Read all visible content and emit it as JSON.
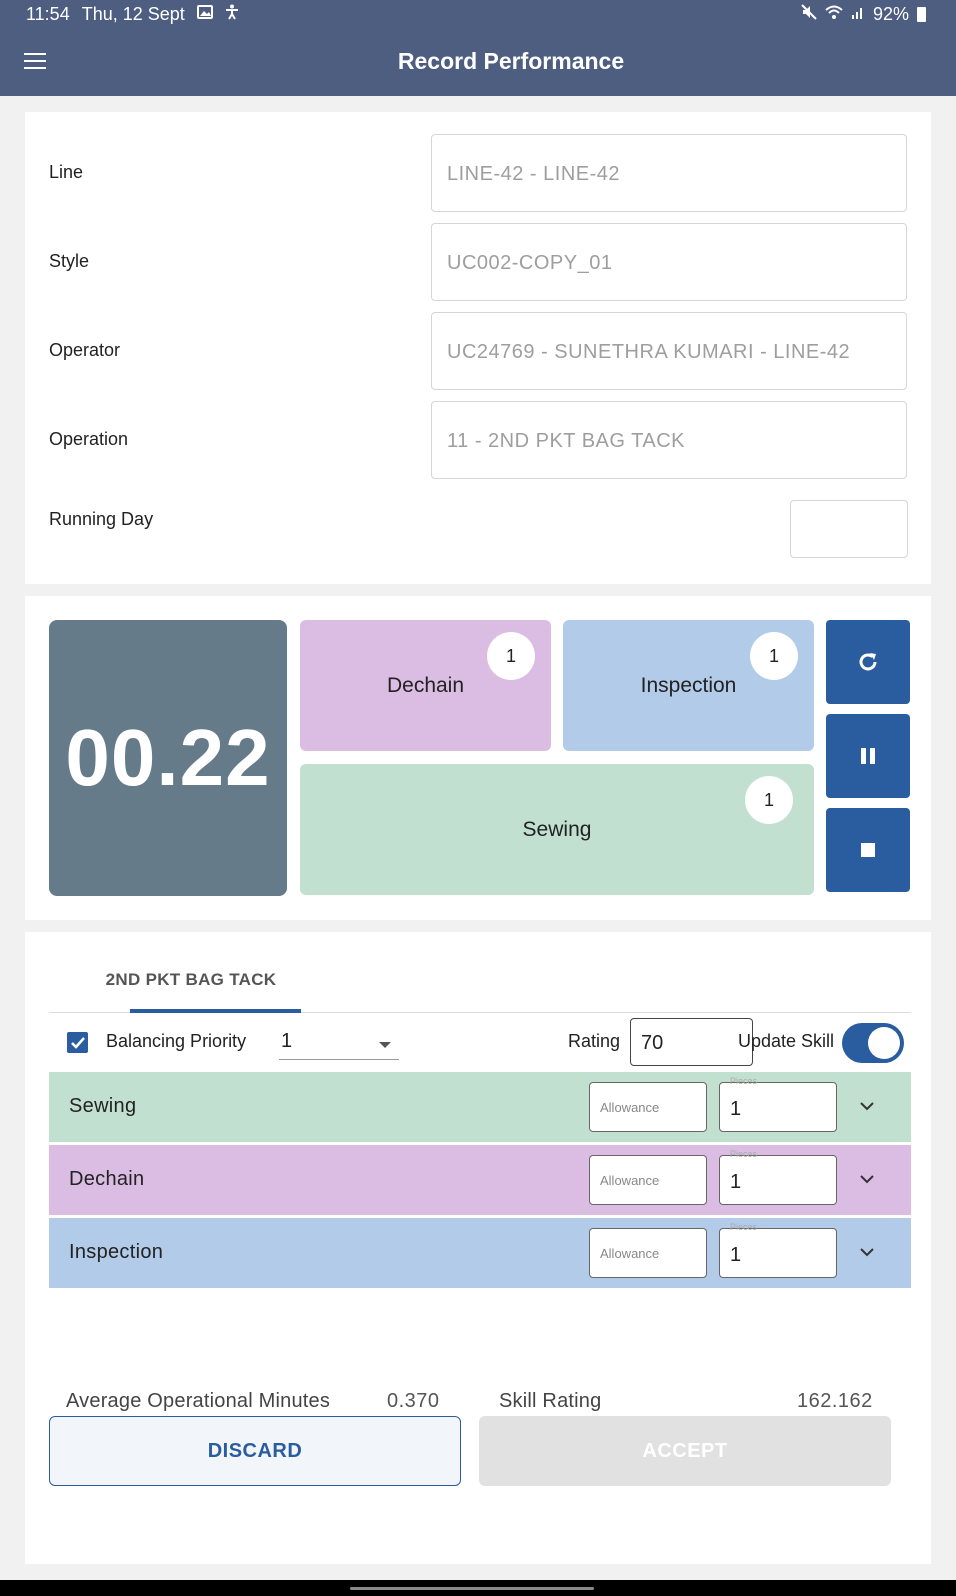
{
  "status_bar": {
    "time": "11:54",
    "date": "Thu, 12 Sept",
    "battery": "92%",
    "icons": [
      "image-icon",
      "accessibility-icon",
      "mute-icon",
      "wifi-icon",
      "signal-icon",
      "battery-icon"
    ]
  },
  "app_bar": {
    "title": "Record Performance",
    "menu_icon": "menu-icon",
    "background": "#4d5e80"
  },
  "details": {
    "line": {
      "label": "Line",
      "value": "LINE-42 - LINE-42"
    },
    "style": {
      "label": "Style",
      "value": "UC002-COPY_01"
    },
    "operator": {
      "label": "Operator",
      "value": "UC24769 - SUNETHRA  KUMARI - LINE-42"
    },
    "operation": {
      "label": "Operation",
      "value": "11 - 2ND PKT BAG TACK"
    },
    "running_day": {
      "label": "Running Day",
      "value": ""
    }
  },
  "timer": {
    "value": "00.22",
    "tiles": {
      "dechain": {
        "label": "Dechain",
        "count": "1",
        "color": "#dbbde4"
      },
      "inspection": {
        "label": "Inspection",
        "count": "1",
        "color": "#b1cbe9"
      },
      "sewing": {
        "label": "Sewing",
        "count": "1",
        "color": "#c2e0d0"
      }
    },
    "controls": [
      "refresh-icon",
      "pause-icon",
      "stop-icon"
    ]
  },
  "operation_panel": {
    "tab_label": "2ND PKT BAG TACK",
    "balancing_priority": {
      "label": "Balancing Priority",
      "checked": true,
      "value": "1"
    },
    "rating": {
      "label": "Rating",
      "value": "70"
    },
    "update_skill": {
      "label": "Update Skill",
      "on": true
    },
    "rows": [
      {
        "name": "Sewing",
        "allowance_placeholder": "Allowance",
        "pieces_label": "Pieces",
        "pieces": "1"
      },
      {
        "name": "Dechain",
        "allowance_placeholder": "Allowance",
        "pieces_label": "Pieces",
        "pieces": "1"
      },
      {
        "name": "Inspection",
        "allowance_placeholder": "Allowance",
        "pieces_label": "Pieces",
        "pieces": "1"
      }
    ],
    "avg_op_minutes": {
      "label": "Average Operational Minutes",
      "value": "0.370"
    },
    "skill_rating": {
      "label": "Skill Rating",
      "value": "162.162"
    },
    "discard_label": "DISCARD",
    "accept_label": "ACCEPT"
  },
  "colors": {
    "accent": "#2a5d9f",
    "timer_bg": "#667b89"
  }
}
